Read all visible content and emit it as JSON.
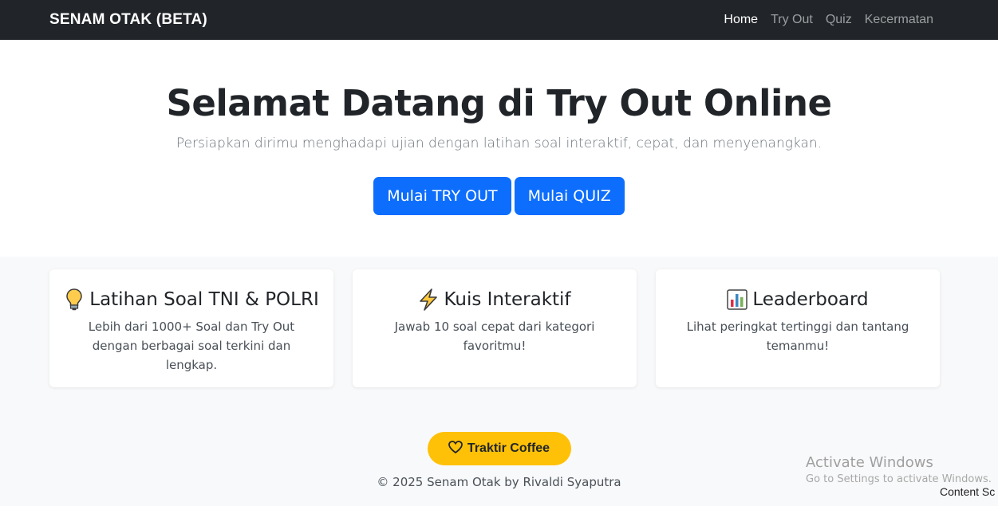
{
  "navbar": {
    "brand": "SENAM OTAK (BETA)",
    "links": [
      {
        "label": "Home",
        "active": true
      },
      {
        "label": "Try Out",
        "active": false
      },
      {
        "label": "Quiz",
        "active": false
      },
      {
        "label": "Kecermatan",
        "active": false
      }
    ]
  },
  "hero": {
    "title": "Selamat Datang di Try Out Online",
    "subtitle": "Persiapkan dirimu menghadapi ujian dengan latihan soal interaktif, cepat, dan menyenangkan.",
    "buttons": [
      "Mulai TRY OUT",
      "Mulai QUIZ"
    ]
  },
  "features": [
    {
      "icon": "lightbulb-icon",
      "title": "Latihan Soal TNI & POLRI",
      "text": "Lebih dari 1000+ Soal dan Try Out dengan berbagai soal terkini dan lengkap."
    },
    {
      "icon": "lightning-icon",
      "title": "Kuis Interaktif",
      "text": "Jawab 10 soal cepat dari kategori favoritmu!"
    },
    {
      "icon": "bar-chart-icon",
      "title": "Leaderboard",
      "text": "Lihat peringkat tertinggi dan tantang temanmu!"
    }
  ],
  "footer": {
    "coffee_label": "Traktir Coffee",
    "copyright": "© 2025 Senam Otak by Rivaldi Syaputra"
  },
  "overlay": {
    "activate_title": "Activate Windows",
    "activate_sub": "Go to Settings to activate Windows.",
    "content_tag": "Content Sc"
  },
  "colors": {
    "navbar_bg": "#212529",
    "primary": "#0d6efd",
    "coffee": "#ffc107",
    "page_bg": "#f8f9fa"
  }
}
